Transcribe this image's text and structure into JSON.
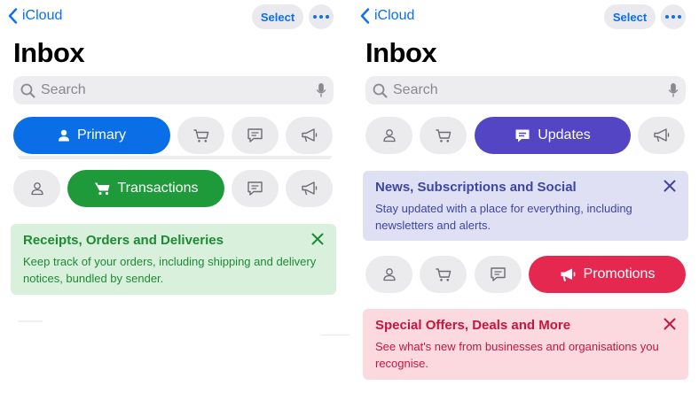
{
  "nav": {
    "back_label": "iCloud",
    "select_label": "Select"
  },
  "header": {
    "title": "Inbox"
  },
  "search": {
    "placeholder": "Search"
  },
  "categories": {
    "primary": "Primary",
    "transactions": "Transactions",
    "updates": "Updates",
    "promotions": "Promotions"
  },
  "cards": {
    "transactions": {
      "title": "Receipts, Orders and Deliveries",
      "body": "Keep track of your orders, including shipping and delivery notices, bundled by sender."
    },
    "updates": {
      "title": "News, Subscriptions and Social",
      "body": "Stay updated with a place for everything, including newsletters and alerts."
    },
    "promotions": {
      "title": "Special Offers, Deals and More",
      "body": "See what's new from businesses and organisations you recognise."
    }
  },
  "colors": {
    "accent": "#0a6ff0",
    "primary_active": "#0a6fe6",
    "transactions_active": "#1f9a3a",
    "updates_active": "#5345c4",
    "promotions_active": "#e5284f"
  },
  "icons": [
    "chevron-left-icon",
    "more-icon",
    "search-icon",
    "microphone-icon",
    "person-icon",
    "cart-icon",
    "message-icon",
    "megaphone-icon",
    "close-icon"
  ]
}
